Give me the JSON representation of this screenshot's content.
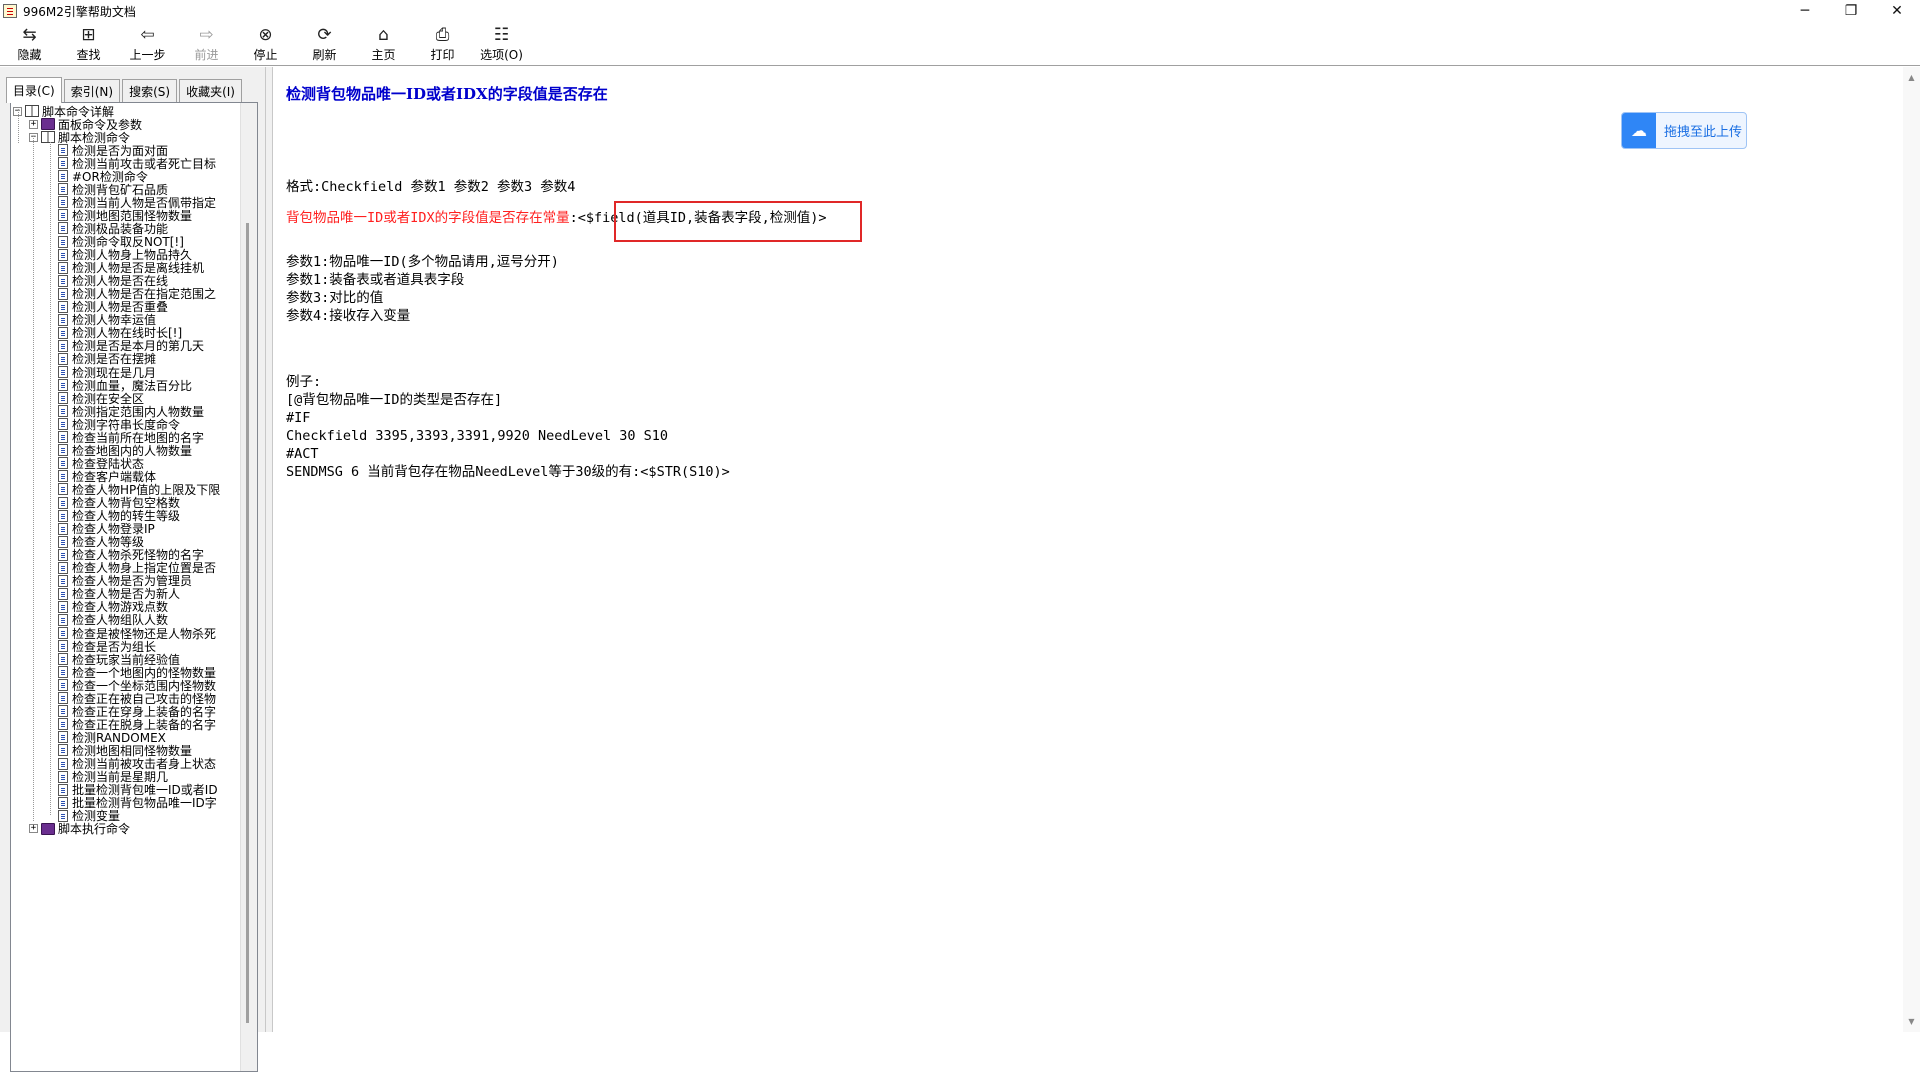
{
  "window": {
    "title": "996M2引擎帮助文档",
    "minimize": "─",
    "maximize": "❐",
    "close": "✕"
  },
  "toolbar": [
    {
      "label": "隐藏",
      "icon": "hide-icon",
      "glyph": "⇆",
      "enabled": true
    },
    {
      "label": "查找",
      "icon": "find-icon",
      "glyph": "⊞",
      "enabled": true
    },
    {
      "label": "上一步",
      "icon": "back-icon",
      "glyph": "⇦",
      "enabled": true
    },
    {
      "label": "前进",
      "icon": "forward-icon",
      "glyph": "⇨",
      "enabled": false
    },
    {
      "label": "停止",
      "icon": "stop-icon",
      "glyph": "⊗",
      "enabled": true
    },
    {
      "label": "刷新",
      "icon": "refresh-icon",
      "glyph": "⟳",
      "enabled": true
    },
    {
      "label": "主页",
      "icon": "home-icon",
      "glyph": "⌂",
      "enabled": true
    },
    {
      "label": "打印",
      "icon": "print-icon",
      "glyph": "⎙",
      "enabled": true
    },
    {
      "label": "选项(O)",
      "icon": "options-icon",
      "glyph": "☷",
      "enabled": true
    }
  ],
  "tabs": [
    {
      "label": "目录(C)",
      "active": true
    },
    {
      "label": "索引(N)",
      "active": false
    },
    {
      "label": "搜索(S)",
      "active": false
    },
    {
      "label": "收藏夹(I)",
      "active": false
    }
  ],
  "tree": {
    "root": {
      "label": "脚本命令详解",
      "expander": "−"
    },
    "panel_commands": {
      "label": "面板命令及参数",
      "expander": "+"
    },
    "script_check": {
      "label": "脚本检测命令",
      "expander": "−"
    },
    "items": [
      "检测是否为面对面",
      "检测当前攻击或者死亡目标",
      "#OR检测命令",
      "检测背包矿石品质",
      "检测当前人物是否佩带指定",
      "检测地图范围怪物数量",
      "检测极品装备功能",
      "检测命令取反NOT[!]",
      "检测人物身上物品持久",
      "检测人物是否是离线挂机",
      "检测人物是否在线",
      "检测人物是否在指定范围之",
      "检测人物是否重叠",
      "检测人物幸运值",
      "检测人物在线时长[!]",
      "检测是否是本月的第几天",
      "检测是否在摆摊",
      "检测现在是几月",
      "检测血量，魔法百分比",
      "检测在安全区",
      "检测指定范围内人物数量",
      "检测字符串长度命令",
      "检查当前所在地图的名字",
      "检查地图内的人物数量",
      "检查登陆状态",
      "检查客户端载体",
      "检查人物HP值的上限及下限",
      "检查人物背包空格数",
      "检查人物的转生等级",
      "检查人物登录IP",
      "检查人物等级",
      "检查人物杀死怪物的名字",
      "检查人物身上指定位置是否",
      "检查人物是否为管理员",
      "检查人物是否为新人",
      "检查人物游戏点数",
      "检查人物组队人数",
      "检查是被怪物还是人物杀死",
      "检查是否为组长",
      "检查玩家当前经验值",
      "检查一个地图内的怪物数量",
      "检查一个坐标范围内怪物数",
      "检查正在被自己攻击的怪物",
      "检查正在穿身上装备的名字",
      "检查正在脱身上装备的名字",
      "检测RANDOMEX",
      "检测地图相同怪物数量",
      "检测当前被攻击者身上状态",
      "检测当前是星期几",
      "批量检测背包唯一ID或者ID",
      "批量检测背包物品唯一ID字",
      "检测变量"
    ],
    "exec_commands": {
      "label": "脚本执行命令",
      "expander": "+"
    }
  },
  "content": {
    "title": "检测背包物品唯一ID或者IDX的字段值是否存在",
    "format_line": "格式:Checkfield 参数1 参数2 参数3 参数4",
    "constant_label": "背包物品唯一ID或者IDX的字段值是否存在常量",
    "constant_value": ":<$field(道具ID,装备表字段,检测值)>",
    "params": [
      "参数1:物品唯一ID(多个物品请用,逗号分开)",
      "参数1:装备表或者道具表字段",
      "参数3:对比的值",
      "参数4:接收存入变量"
    ],
    "example_label": "例子:",
    "example_lines": [
      "[@背包物品唯一ID的类型是否存在]",
      "#IF",
      "Checkfield 3395,3393,3391,9920 NeedLevel 30 S10",
      "#ACT",
      "SENDMSG 6 当前背包存在物品NeedLevel等于30级的有:<$STR(S10)>"
    ],
    "upload_button": "拖拽至此上传"
  },
  "colors": {
    "title_blue": "#0000cc",
    "constant_red": "#ff2020",
    "highlight_red": "#e02828",
    "upload_blue": "#2f86f6"
  }
}
